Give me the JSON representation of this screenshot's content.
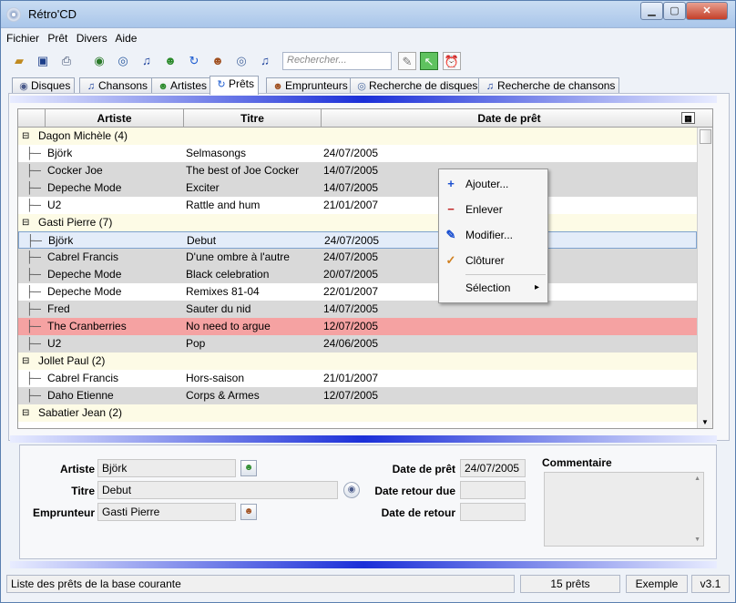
{
  "window": {
    "title": "Rétro'CD"
  },
  "menu": [
    "Fichier",
    "Prêt",
    "Divers",
    "Aide"
  ],
  "search": {
    "placeholder": "Rechercher..."
  },
  "tabs": [
    {
      "label": "Disques",
      "icon": "disc-icon",
      "glyph": "◉"
    },
    {
      "label": "Chansons",
      "icon": "music-note-icon",
      "glyph": "♫"
    },
    {
      "label": "Artistes",
      "icon": "person-icon",
      "glyph": "☻"
    },
    {
      "label": "Prêts",
      "icon": "loan-arrow-icon",
      "glyph": "↻"
    },
    {
      "label": "Emprunteurs",
      "icon": "borrower-icon",
      "glyph": "☻"
    },
    {
      "label": "Recherche de disques",
      "icon": "search-disc-icon",
      "glyph": "◎"
    },
    {
      "label": "Recherche de chansons",
      "icon": "search-song-icon",
      "glyph": "♫"
    }
  ],
  "grid": {
    "headers": [
      "Artiste",
      "Titre",
      "Date de prêt"
    ],
    "rows": [
      {
        "type": "group",
        "label": "Dagon Michèle (4)"
      },
      {
        "type": "white",
        "artist": "Björk",
        "title": "Selmasongs",
        "date": "24/07/2005"
      },
      {
        "type": "gray",
        "artist": "Cocker Joe",
        "title": "The best of Joe Cocker",
        "date": "14/07/2005"
      },
      {
        "type": "gray",
        "artist": "Depeche Mode",
        "title": "Exciter",
        "date": "14/07/2005"
      },
      {
        "type": "white",
        "artist": "U2",
        "title": "Rattle and hum",
        "date": "21/01/2007"
      },
      {
        "type": "group",
        "label": "Gasti Pierre (7)"
      },
      {
        "type": "sel",
        "artist": "Björk",
        "title": "Debut",
        "date": "24/07/2005"
      },
      {
        "type": "gray",
        "artist": "Cabrel Francis",
        "title": "D'une ombre à l'autre",
        "date": "24/07/2005"
      },
      {
        "type": "gray",
        "artist": "Depeche Mode",
        "title": "Black celebration",
        "date": "20/07/2005"
      },
      {
        "type": "white",
        "artist": "Depeche Mode",
        "title": "Remixes 81-04",
        "date": "22/01/2007"
      },
      {
        "type": "gray",
        "artist": "Fred",
        "title": "Sauter du nid",
        "date": "14/07/2005"
      },
      {
        "type": "red",
        "artist": "The Cranberries",
        "title": "No need to argue",
        "date": "12/07/2005"
      },
      {
        "type": "gray",
        "artist": "U2",
        "title": "Pop",
        "date": "24/06/2005"
      },
      {
        "type": "group",
        "label": "Jollet Paul (2)"
      },
      {
        "type": "white",
        "artist": "Cabrel Francis",
        "title": "Hors-saison",
        "date": "21/01/2007"
      },
      {
        "type": "gray",
        "artist": "Daho Etienne",
        "title": "Corps & Armes",
        "date": "12/07/2005"
      },
      {
        "type": "group",
        "label": "Sabatier Jean (2)"
      }
    ]
  },
  "context_menu": [
    {
      "label": "Ajouter...",
      "icon": "add-loan-icon",
      "glyph": "+"
    },
    {
      "label": "Enlever",
      "icon": "remove-loan-icon",
      "glyph": "−"
    },
    {
      "label": "Modifier...",
      "icon": "edit-loan-icon",
      "glyph": "✎"
    },
    {
      "label": "Clôturer",
      "icon": "close-loan-icon",
      "glyph": "✓"
    },
    {
      "label": "Sélection",
      "icon": "submenu-arrow-icon",
      "glyph": "▸"
    }
  ],
  "detail": {
    "artist_label": "Artiste",
    "artist_value": "Björk",
    "title_label": "Titre",
    "title_value": "Debut",
    "borrower_label": "Emprunteur",
    "borrower_value": "Gasti Pierre",
    "loan_date_label": "Date de prêt",
    "loan_date_value": "24/07/2005",
    "due_date_label": "Date retour due",
    "due_date_value": "",
    "return_date_label": "Date de retour",
    "return_date_value": "",
    "comment_label": "Commentaire"
  },
  "status": {
    "message": "Liste des prêts de la base courante",
    "count": "15 prêts",
    "db": "Exemple",
    "version": "v3.1"
  }
}
